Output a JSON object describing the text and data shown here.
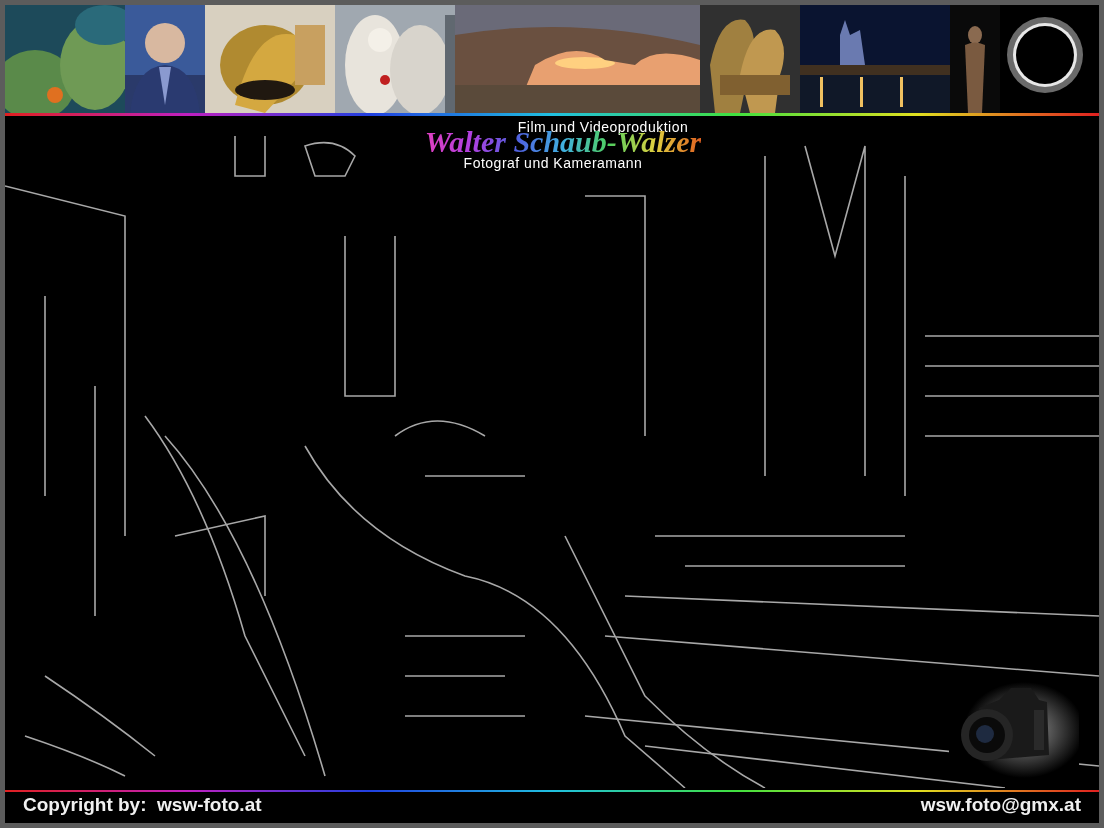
{
  "logo": {
    "tagline_top": "Film und Videoproduktion",
    "name": "Walter Schaub-Walzer",
    "tagline_bottom": "Fotograf und Kameramann"
  },
  "footer": {
    "copyright": "Copyright by:  wsw-foto.at",
    "email": "wsw.foto@gmx.at"
  }
}
